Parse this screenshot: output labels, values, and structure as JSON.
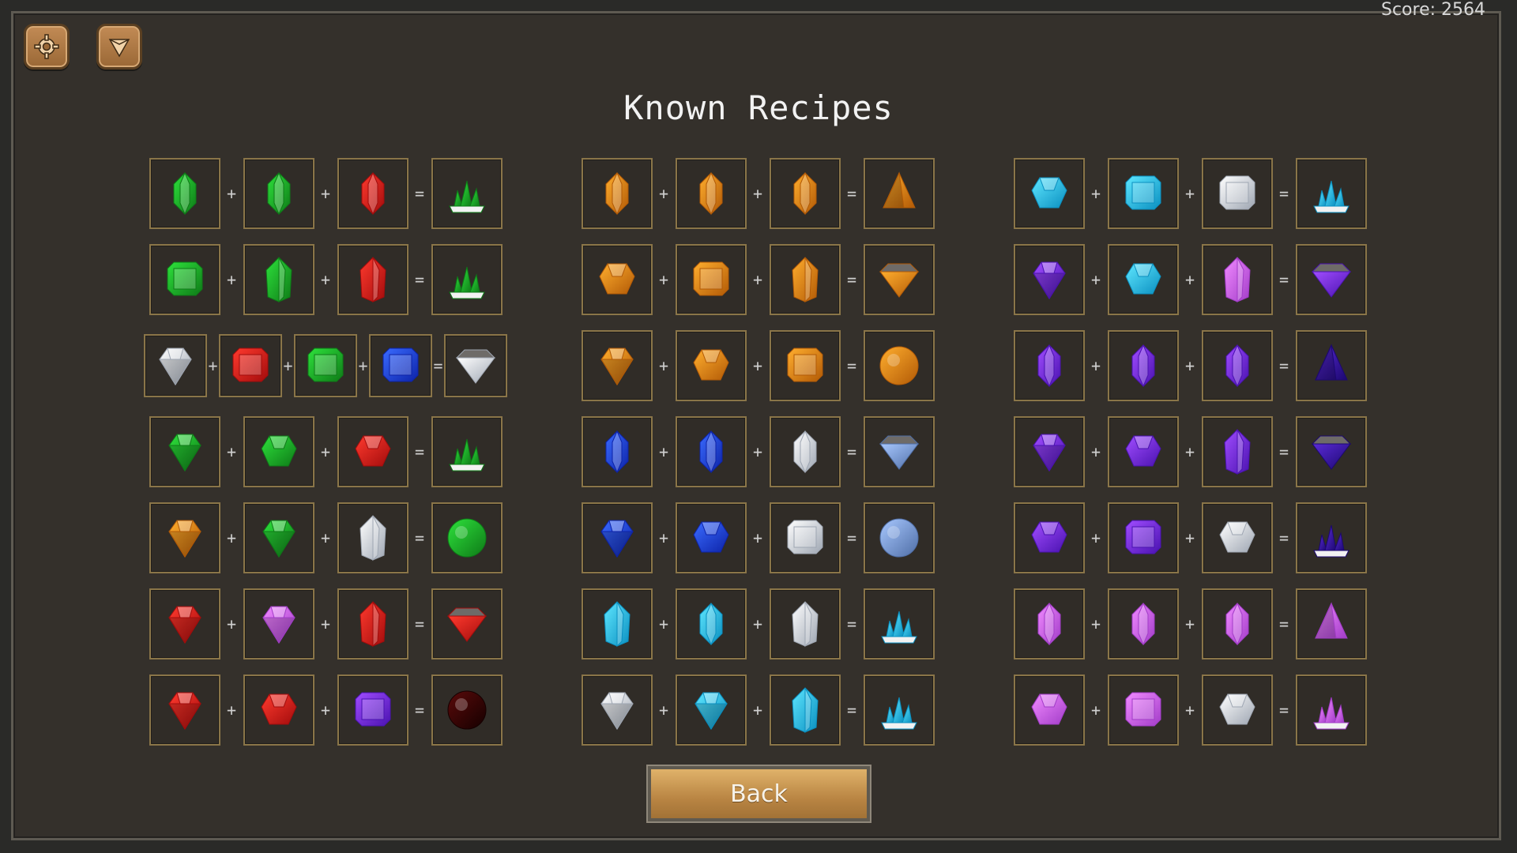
{
  "screen": {
    "title": "Known Recipes",
    "back_label": "Back",
    "score_label": "Score: 2564"
  },
  "toolbar": {
    "settings_icon": "gear-icon",
    "gem_icon": "gem-icon"
  },
  "recipes": [
    [
      [
        [
          "green",
          "gem"
        ],
        [
          "green",
          "gem"
        ],
        [
          "red",
          "gem"
        ],
        [
          "green",
          "cluster"
        ]
      ],
      [
        [
          "green",
          "square"
        ],
        [
          "green",
          "tall"
        ],
        [
          "red",
          "tall"
        ],
        [
          "green",
          "cluster"
        ]
      ],
      [
        [
          "white",
          "round"
        ],
        [
          "red",
          "square"
        ],
        [
          "green",
          "square"
        ],
        [
          "blue",
          "square"
        ],
        [
          "white",
          "fan"
        ]
      ],
      [
        [
          "green",
          "round"
        ],
        [
          "green",
          "octa"
        ],
        [
          "red",
          "octa"
        ],
        [
          "green",
          "cluster"
        ]
      ],
      [
        [
          "orange",
          "round"
        ],
        [
          "green",
          "round"
        ],
        [
          "white",
          "tall"
        ],
        [
          "green",
          "orb"
        ]
      ],
      [
        [
          "red",
          "round"
        ],
        [
          "pink",
          "round"
        ],
        [
          "red",
          "tall"
        ],
        [
          "red",
          "fan"
        ]
      ],
      [
        [
          "red",
          "round"
        ],
        [
          "red",
          "octa"
        ],
        [
          "purple",
          "square"
        ],
        [
          "darkred",
          "orb"
        ]
      ]
    ],
    [
      [
        [
          "orange",
          "gem"
        ],
        [
          "orange",
          "gem"
        ],
        [
          "orange",
          "gem"
        ],
        [
          "orange",
          "pyramid"
        ]
      ],
      [
        [
          "orange",
          "octa"
        ],
        [
          "orange",
          "square"
        ],
        [
          "orange",
          "tall"
        ],
        [
          "orange",
          "fan"
        ]
      ],
      [
        [
          "orange",
          "round"
        ],
        [
          "orange",
          "octa"
        ],
        [
          "orange",
          "square"
        ],
        [
          "orange",
          "orb"
        ]
      ],
      [
        [
          "blue",
          "gem"
        ],
        [
          "blue",
          "gem"
        ],
        [
          "white",
          "gem"
        ],
        [
          "lightblue",
          "fan"
        ]
      ],
      [
        [
          "blue",
          "round"
        ],
        [
          "blue",
          "octa"
        ],
        [
          "white",
          "square"
        ],
        [
          "lightblue",
          "orb"
        ]
      ],
      [
        [
          "cyan",
          "tall"
        ],
        [
          "cyan",
          "gem"
        ],
        [
          "white",
          "tall"
        ],
        [
          "cyan",
          "cluster"
        ]
      ],
      [
        [
          "white",
          "round"
        ],
        [
          "cyan",
          "round"
        ],
        [
          "cyan",
          "tall"
        ],
        [
          "cyan",
          "cluster"
        ]
      ]
    ],
    [
      [
        [
          "cyan",
          "octa"
        ],
        [
          "cyan",
          "square"
        ],
        [
          "white",
          "square"
        ],
        [
          "cyan",
          "cluster"
        ]
      ],
      [
        [
          "purple",
          "round"
        ],
        [
          "cyan",
          "octa"
        ],
        [
          "pink",
          "tall"
        ],
        [
          "purple",
          "fan"
        ]
      ],
      [
        [
          "purple",
          "gem"
        ],
        [
          "purple",
          "gem"
        ],
        [
          "purple",
          "gem"
        ],
        [
          "darkpurple",
          "pyramid"
        ]
      ],
      [
        [
          "purple",
          "round"
        ],
        [
          "purple",
          "octa"
        ],
        [
          "purple",
          "tall"
        ],
        [
          "darkpurple",
          "fan"
        ]
      ],
      [
        [
          "purple",
          "octa"
        ],
        [
          "purple",
          "square"
        ],
        [
          "white",
          "octa"
        ],
        [
          "darkpurple",
          "cluster"
        ]
      ],
      [
        [
          "pink",
          "gem"
        ],
        [
          "pink",
          "gem"
        ],
        [
          "pink",
          "gem"
        ],
        [
          "pink",
          "pyramid"
        ]
      ],
      [
        [
          "pink",
          "octa"
        ],
        [
          "pink",
          "square"
        ],
        [
          "white",
          "octa"
        ],
        [
          "pink",
          "cluster"
        ]
      ]
    ]
  ],
  "gem_colors": {
    "green": [
      "#2ee13c",
      "#0e7a17"
    ],
    "red": [
      "#ff3a2e",
      "#a20c0c"
    ],
    "orange": [
      "#ffae2e",
      "#b25a06"
    ],
    "blue": [
      "#3a6bff",
      "#0d23a8"
    ],
    "cyan": [
      "#5fe7ff",
      "#0a8fc0"
    ],
    "white": [
      "#ffffff",
      "#9ea6b2"
    ],
    "purple": [
      "#a14dff",
      "#4a12b0"
    ],
    "darkpurple": [
      "#5a2ad6",
      "#1c0870"
    ],
    "pink": [
      "#f18bff",
      "#a23cc8"
    ],
    "lightblue": [
      "#a8c8ff",
      "#4f6ea6"
    ],
    "darkred": [
      "#5a0a0a",
      "#150000"
    ]
  }
}
